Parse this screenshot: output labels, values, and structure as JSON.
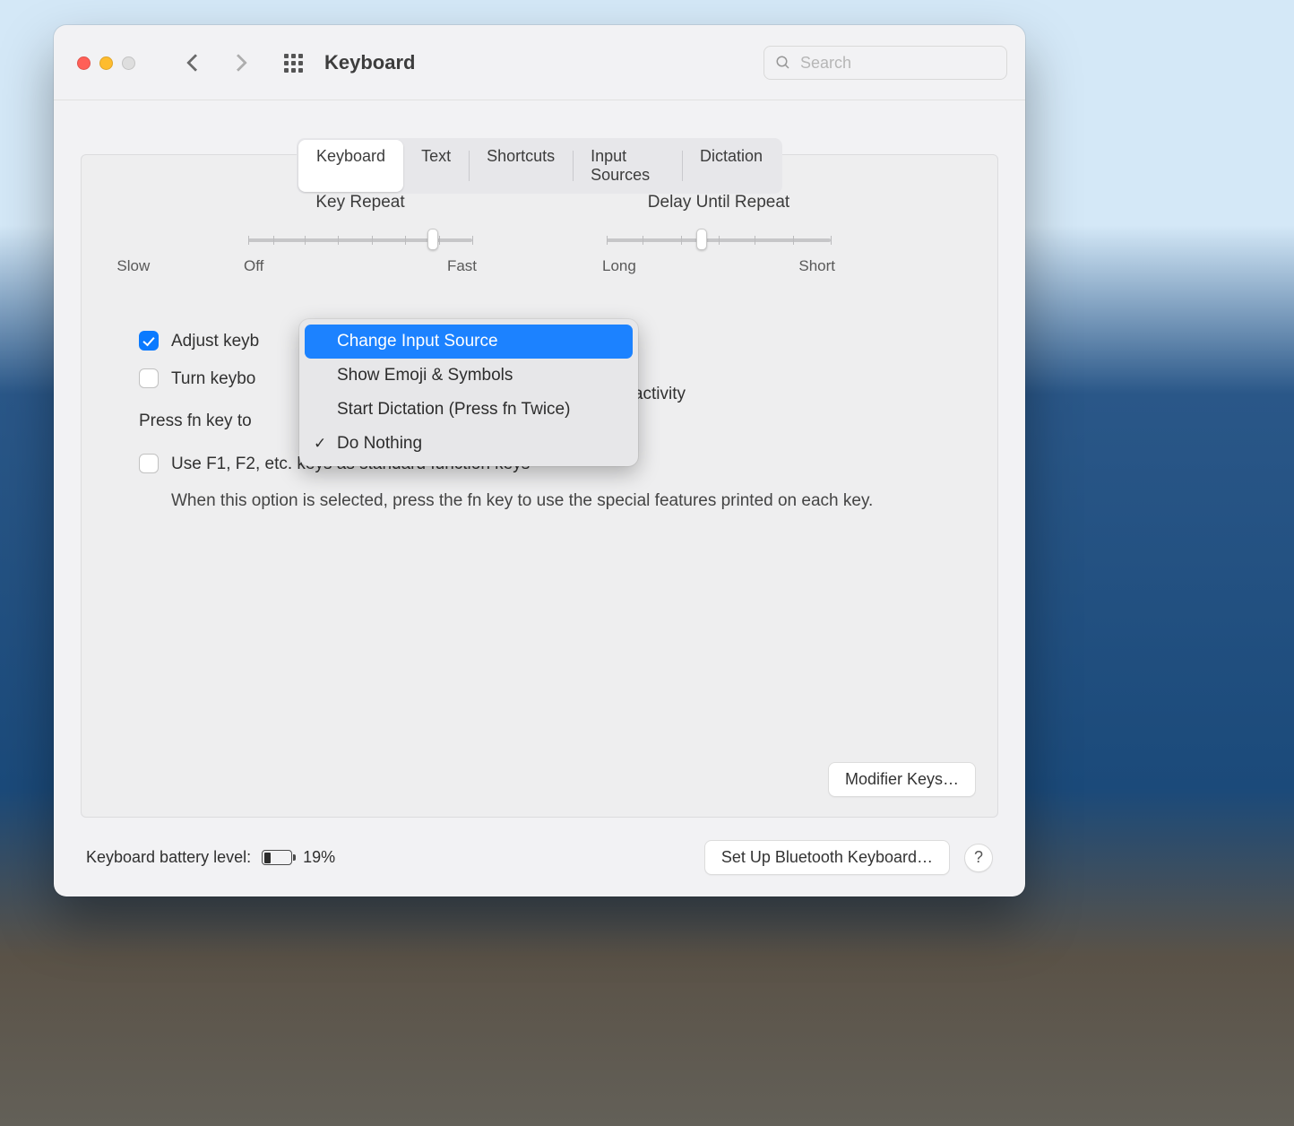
{
  "titlebar": {
    "title": "Keyboard",
    "search_placeholder": "Search"
  },
  "tabs": [
    "Keyboard",
    "Text",
    "Shortcuts",
    "Input Sources",
    "Dictation"
  ],
  "active_tab_index": 0,
  "sliders": {
    "key_repeat": {
      "label": "Key Repeat",
      "left_label": "Off",
      "mid_label": "Slow",
      "right_label": "Fast"
    },
    "delay": {
      "label": "Delay Until Repeat",
      "left_label": "Long",
      "right_label": "Short"
    }
  },
  "options": {
    "adjust_brightness_label": "Adjust keyb",
    "turn_off_label": "Turn keybo",
    "turn_off_after_trail": "of inactivity",
    "press_fn_label": "Press fn key to",
    "use_fkeys_label": "Use F1, F2, etc. keys as standard function keys",
    "use_fkeys_explain": "When this option is selected, press the fn key to use the special features printed on each key.",
    "adjust_checked": true,
    "turn_off_checked": false,
    "use_fkeys_checked": false
  },
  "fn_menu": {
    "items": [
      "Change Input Source",
      "Show Emoji & Symbols",
      "Start Dictation (Press fn Twice)",
      "Do Nothing"
    ],
    "highlight_index": 0,
    "checked_index": 3
  },
  "buttons": {
    "modifier_keys": "Modifier Keys…",
    "bluetooth": "Set Up Bluetooth Keyboard…"
  },
  "footer": {
    "battery_label": "Keyboard battery level:",
    "battery_percent": "19%",
    "help": "?"
  }
}
